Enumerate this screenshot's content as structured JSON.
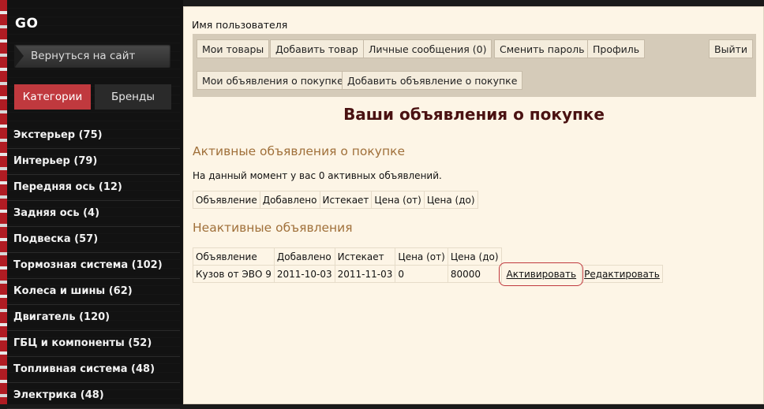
{
  "sidebar": {
    "logo": "GO",
    "back_label": "Вернуться на сайт",
    "tabs": {
      "categories": "Категории",
      "brands": "Бренды"
    },
    "categories": [
      "Экстерьер (75)",
      "Интерьер (79)",
      "Передняя ось (12)",
      "Задняя ось (4)",
      "Подвеска (57)",
      "Тормозная система (102)",
      "Колеса и шины (62)",
      "Двигатель (120)",
      "ГБЦ и компоненты (52)",
      "Топливная система (48)",
      "Электрика (48)"
    ]
  },
  "main": {
    "username": "Имя пользователя",
    "toolbar": {
      "my_items": "Мои товары",
      "add_item": "Добавить товар",
      "messages": "Личные сообщения (0)",
      "change_password": "Сменить пароль",
      "profile": "Профиль",
      "logout": "Выйти",
      "my_ads": "Мои объявления о покупке",
      "add_ad": "Добавить объявление о покупке"
    },
    "title": "Ваши объявления о покупке",
    "active": {
      "heading": "Активные объявления о покупке",
      "note": "На данный момент у вас 0 активных объявлений.",
      "columns": [
        "Объявление",
        "Добавлено",
        "Истекает",
        "Цена (от)",
        "Цена (до)"
      ]
    },
    "inactive": {
      "heading": "Неактивные объявления",
      "columns": [
        "Объявление",
        "Добавлено",
        "Истекает",
        "Цена (от)",
        "Цена (до)"
      ],
      "rows": [
        {
          "ad": "Кузов от ЭВО 9",
          "added": "2011-10-03",
          "expires": "2011-11-03",
          "price_from": "0",
          "price_to": "80000",
          "activate": "Активировать",
          "edit": "Редактировать"
        }
      ]
    }
  },
  "colors": {
    "accent_red": "#c0393e",
    "title_color": "#4a1212",
    "section_color": "#a0703a",
    "panel_bg": "#fdf5e6",
    "toolbar_bg": "#d5cbb9"
  }
}
